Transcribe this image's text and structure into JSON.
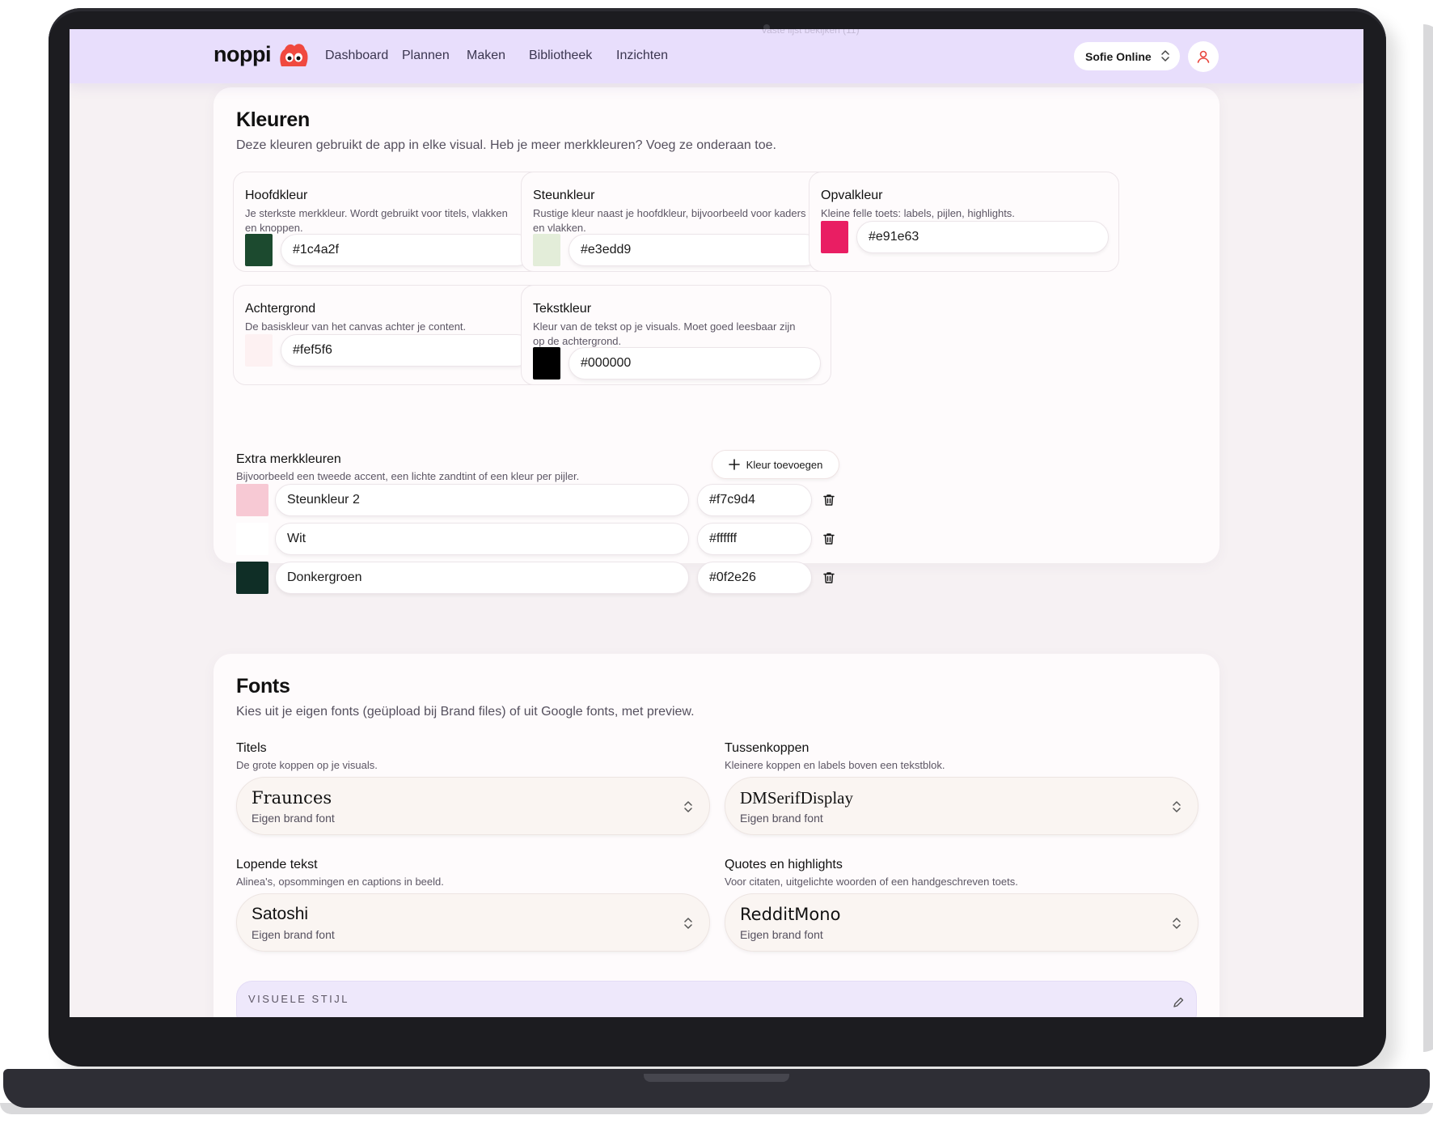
{
  "nav": {
    "brand": "noppi",
    "ghost_link": "Vaste lijst bekijken (11)",
    "items": [
      "Dashboard",
      "Plannen",
      "Maken",
      "Bibliotheek",
      "Inzichten"
    ],
    "account": "Sofie Online"
  },
  "colors": {
    "title": "Kleuren",
    "subtitle": "Deze kleuren gebruikt de app in elke visual. Heb je meer merkkleuren? Voeg ze onderaan toe.",
    "main": [
      {
        "label": "Hoofdkleur",
        "desc": "Je sterkste merkkleur. Wordt gebruikt voor titels, vlakken en knoppen.",
        "value": "#1c4a2f"
      },
      {
        "label": "Steunkleur",
        "desc": "Rustige kleur naast je hoofdkleur, bijvoorbeeld voor kaders en vlakken.",
        "value": "#e3edd9"
      },
      {
        "label": "Opvalkleur",
        "desc": "Kleine felle toets: labels, pijlen, highlights.",
        "value": "#e91e63"
      },
      {
        "label": "Achtergrond",
        "desc": "De basiskleur van het canvas achter je content.",
        "value": "#fef5f6"
      },
      {
        "label": "Tekstkleur",
        "desc": "Kleur van de tekst op je visuals. Moet goed leesbaar zijn op de achtergrond.",
        "value": "#000000"
      }
    ],
    "extra": {
      "label": "Extra merkkleuren",
      "desc": "Bijvoorbeeld een tweede accent, een lichte zandtint of een kleur per pijler.",
      "add_label": "Kleur toevoegen",
      "rows": [
        {
          "name": "Steunkleur 2",
          "value": "#f7c9d4"
        },
        {
          "name": "Wit",
          "value": "#ffffff"
        },
        {
          "name": "Donkergroen",
          "value": "#0f2e26"
        }
      ]
    }
  },
  "fonts": {
    "title": "Fonts",
    "subtitle": "Kies uit je eigen fonts (geüpload bij Brand files) of uit Google fonts, met preview.",
    "items": [
      {
        "label": "Titels",
        "desc": "De grote koppen op je visuals.",
        "font": "Fraunces",
        "source": "Eigen brand font"
      },
      {
        "label": "Tussenkoppen",
        "desc": "Kleinere koppen en labels boven een tekstblok.",
        "font": "DMSerifDisplay",
        "source": "Eigen brand font"
      },
      {
        "label": "Lopende tekst",
        "desc": "Alinea's, opsommingen en captions in beeld.",
        "font": "Satoshi",
        "source": "Eigen brand font"
      },
      {
        "label": "Quotes en highlights",
        "desc": "Voor citaten, uitgelichte woorden of een handgeschreven toets.",
        "font": "RedditMono",
        "source": "Eigen brand font"
      }
    ],
    "style_label": "VISUELE STIJL"
  },
  "theme": {
    "nav_bg": "#e8defc",
    "page_bg": "#f6f1f3",
    "brand_red": "#f0493f",
    "avatar_red": "#e8453c"
  }
}
